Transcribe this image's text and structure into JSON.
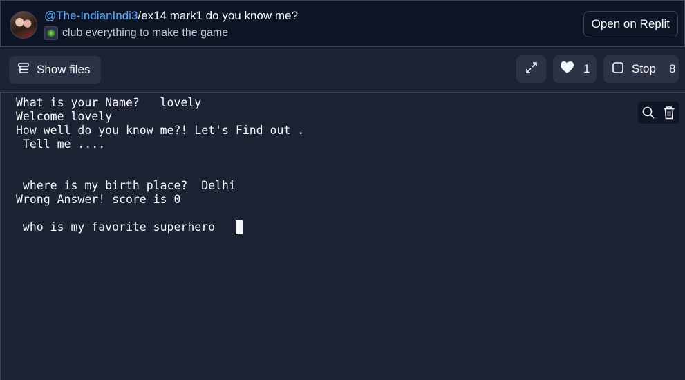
{
  "header": {
    "owner": "@The-IndianIndi3",
    "separator": "/",
    "repl_name": "ex14 mark1 do you know me?",
    "description": "club everything to make the game",
    "open_button": "Open on Replit",
    "lang_icon": "nodejs-icon"
  },
  "toolbar": {
    "show_files": "Show files",
    "like_count": "1",
    "stop_label": "Stop",
    "stop_count": "8",
    "icons": [
      "files-icon",
      "expand-icon",
      "heart-icon",
      "stop-square-icon"
    ]
  },
  "console": {
    "lines": [
      "What is your Name?   lovely",
      "Welcome lovely",
      "How well do you know me?! Let's Find out .",
      " Tell me ....",
      "",
      "",
      " where is my birth place?  Delhi",
      "Wrong Answer! score is 0",
      "",
      " who is my favorite superhero   "
    ],
    "tool_icons": [
      "search-icon",
      "trash-icon"
    ]
  },
  "colors": {
    "bg": "#1c2333",
    "header_bg": "#0e1525",
    "link": "#57abff",
    "button_bg": "#2b3245",
    "border": "#3c445c"
  }
}
